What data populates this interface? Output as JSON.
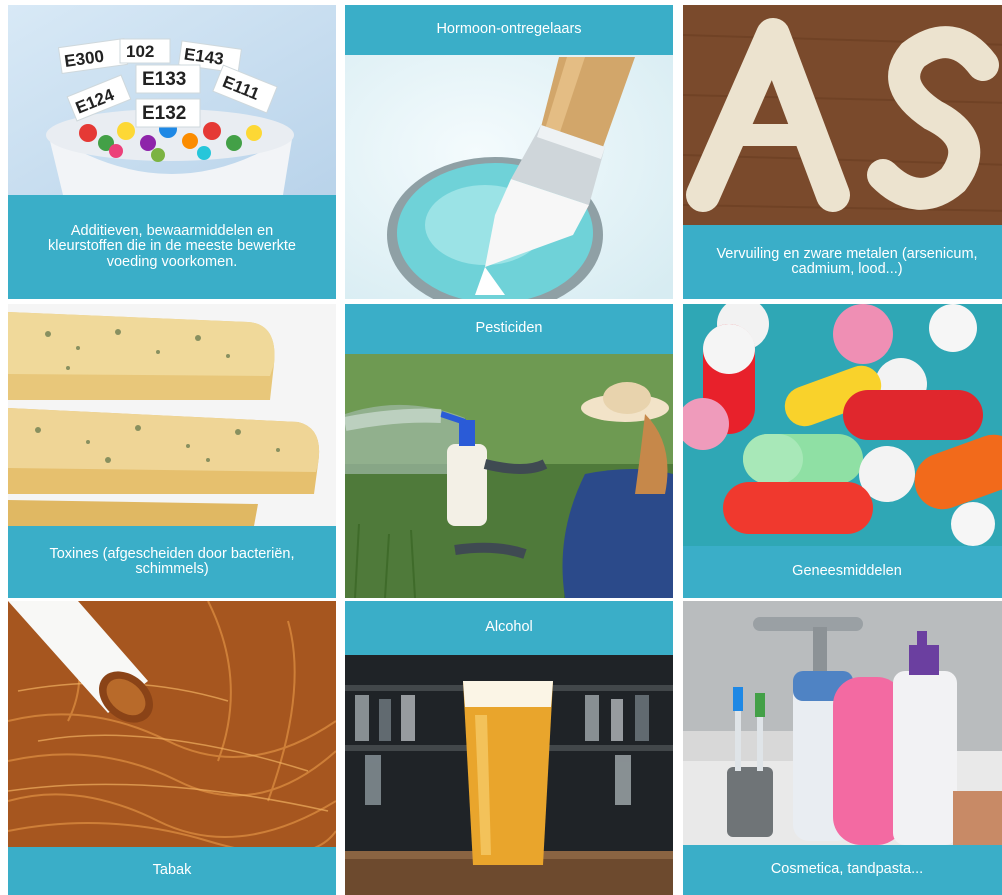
{
  "tiles": [
    {
      "caption": "Additieven, bewaarmiddelen en kleurstoffen die in de meeste bewerkte voeding voorkomen.",
      "labels": [
        "E300",
        "102",
        "E143",
        "E133",
        "E124",
        "E132",
        "E111"
      ]
    },
    {
      "caption": "Hormoon-ontregelaars"
    },
    {
      "caption": "Vervuiling en zware metalen (arsenicum, cadmium, lood...)"
    },
    {
      "caption": "Toxines (afgescheiden door bacteriën, schimmels)"
    },
    {
      "caption": "Pesticiden"
    },
    {
      "caption": "Geneesmiddelen"
    },
    {
      "caption": "Tabak"
    },
    {
      "caption": "Alcohol"
    },
    {
      "caption": "Cosmetica, tandpasta..."
    }
  ],
  "colors": {
    "accent": "#3aaec8",
    "caption_text": "#ffffff"
  }
}
